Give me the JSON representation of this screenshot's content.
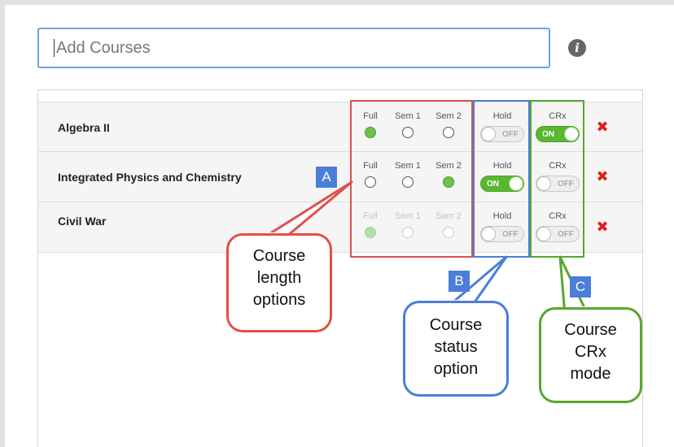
{
  "search": {
    "placeholder": "Add Courses"
  },
  "icons": {
    "info": "i",
    "remove": "✖"
  },
  "columns": {
    "full": "Full",
    "sem1": "Sem 1",
    "sem2": "Sem 2",
    "hold": "Hold",
    "crx": "CRx"
  },
  "toggle_labels": {
    "on": "ON",
    "off": "OFF"
  },
  "courses": [
    {
      "name": "Algebra II",
      "length": "Full",
      "hold": "OFF",
      "crx": "ON",
      "length_enabled": true
    },
    {
      "name": "Integrated Physics and Chemistry",
      "length": "Sem 2",
      "hold": "ON",
      "crx": "OFF",
      "length_enabled": true
    },
    {
      "name": "Civil War",
      "length": "Full",
      "hold": "OFF",
      "crx": "OFF",
      "length_enabled": false
    }
  ],
  "annotations": {
    "a": {
      "tag": "A",
      "lines": [
        "Course",
        "length",
        "options"
      ],
      "color": "#e0504a"
    },
    "b": {
      "tag": "B",
      "lines": [
        "Course",
        "status",
        "option"
      ],
      "color": "#4a7ed8"
    },
    "c": {
      "tag": "C",
      "lines": [
        "Course",
        "CRx",
        "mode"
      ],
      "color": "#5aa630"
    }
  },
  "colors": {
    "accent_green": "#58b82f",
    "remove_red": "#e0201c",
    "search_border": "#6aa4e0"
  }
}
